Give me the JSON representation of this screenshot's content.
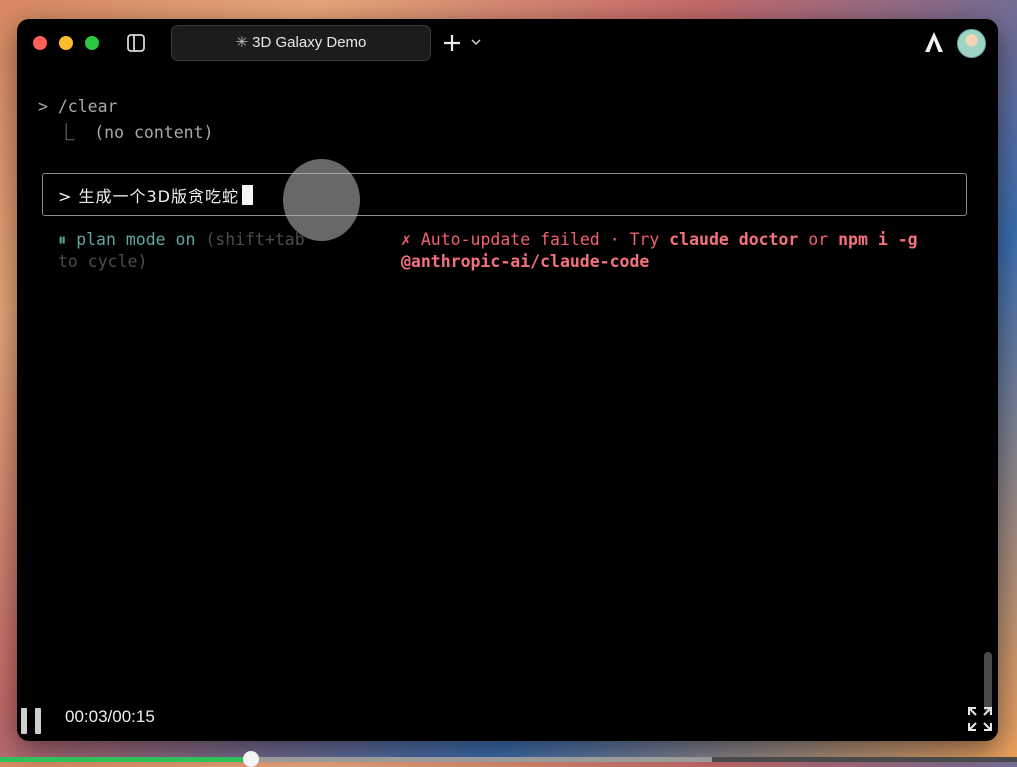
{
  "window": {
    "tab_title": "3D Galaxy Demo",
    "tab_icon": "asterisk-icon"
  },
  "terminal": {
    "command_line": "> /clear",
    "command_result": "  ⎿  (no content)",
    "prompt_prefix": "> ",
    "prompt_input": "生成一个3D版贪吃蛇",
    "plan_mode_icon": "⏸",
    "plan_mode_label": "plan mode on",
    "plan_mode_hint_1": " (shift+tab",
    "plan_mode_hint_2": "to cycle)",
    "error_mark": "✗",
    "error_text_1": " Auto-update failed · Try ",
    "error_cmd_1": "claude doctor",
    "error_text_2": " or ",
    "error_cmd_2": "npm i -g",
    "error_cmd_3": "@anthropic-ai/claude-code"
  },
  "player": {
    "timecode": "00:03/00:15",
    "progress": 0.247,
    "buffered": 0.7
  },
  "colors": {
    "error": "#f0616e",
    "plan": "#5fa8a0",
    "progress": "#2fc25b"
  }
}
